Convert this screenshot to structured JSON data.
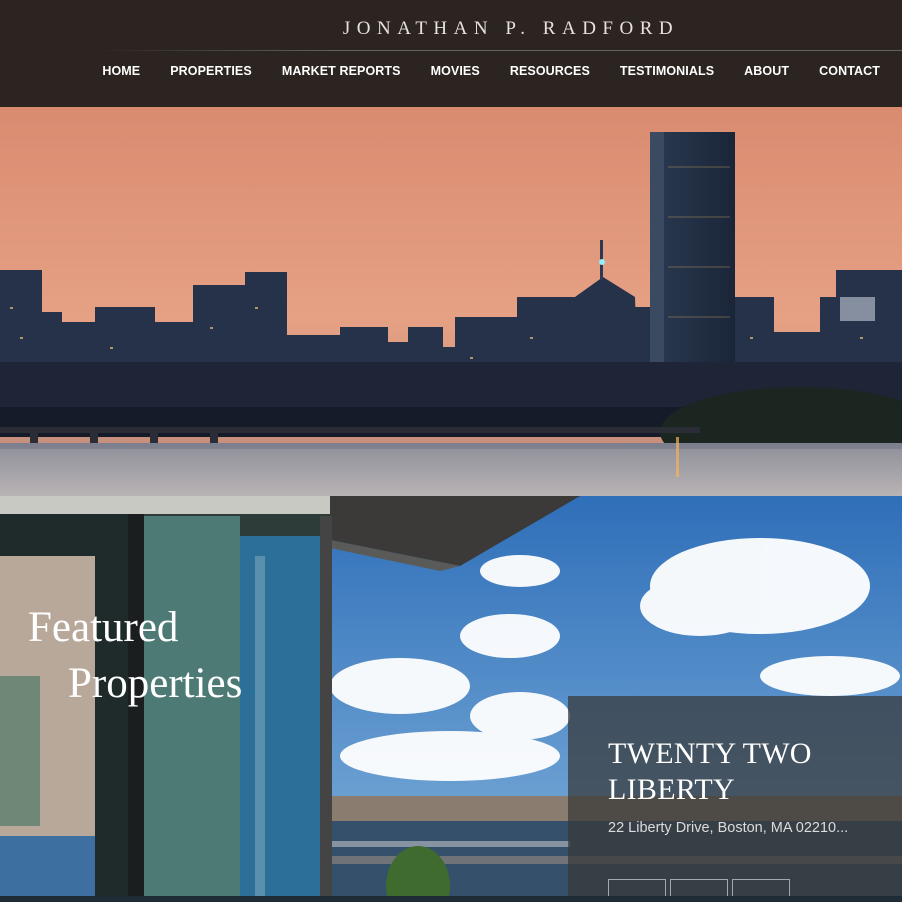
{
  "header": {
    "brand": "JONATHAN P. RADFORD",
    "nav": [
      "HOME",
      "PROPERTIES",
      "MARKET REPORTS",
      "MOVIES",
      "RESOURCES",
      "TESTIMONIALS",
      "ABOUT",
      "CONTACT"
    ]
  },
  "featured": {
    "title_line1": "Featured",
    "title_line2": "Properties",
    "property": {
      "name": "TWENTY TWO LIBERTY",
      "address": "22 Liberty Drive, Boston, MA 02210..."
    }
  },
  "colors": {
    "header_bg": "#2b2421",
    "sky_top": "#d88a6e",
    "sky_blue": "#3d7fc4",
    "card_bg": "#373737"
  }
}
